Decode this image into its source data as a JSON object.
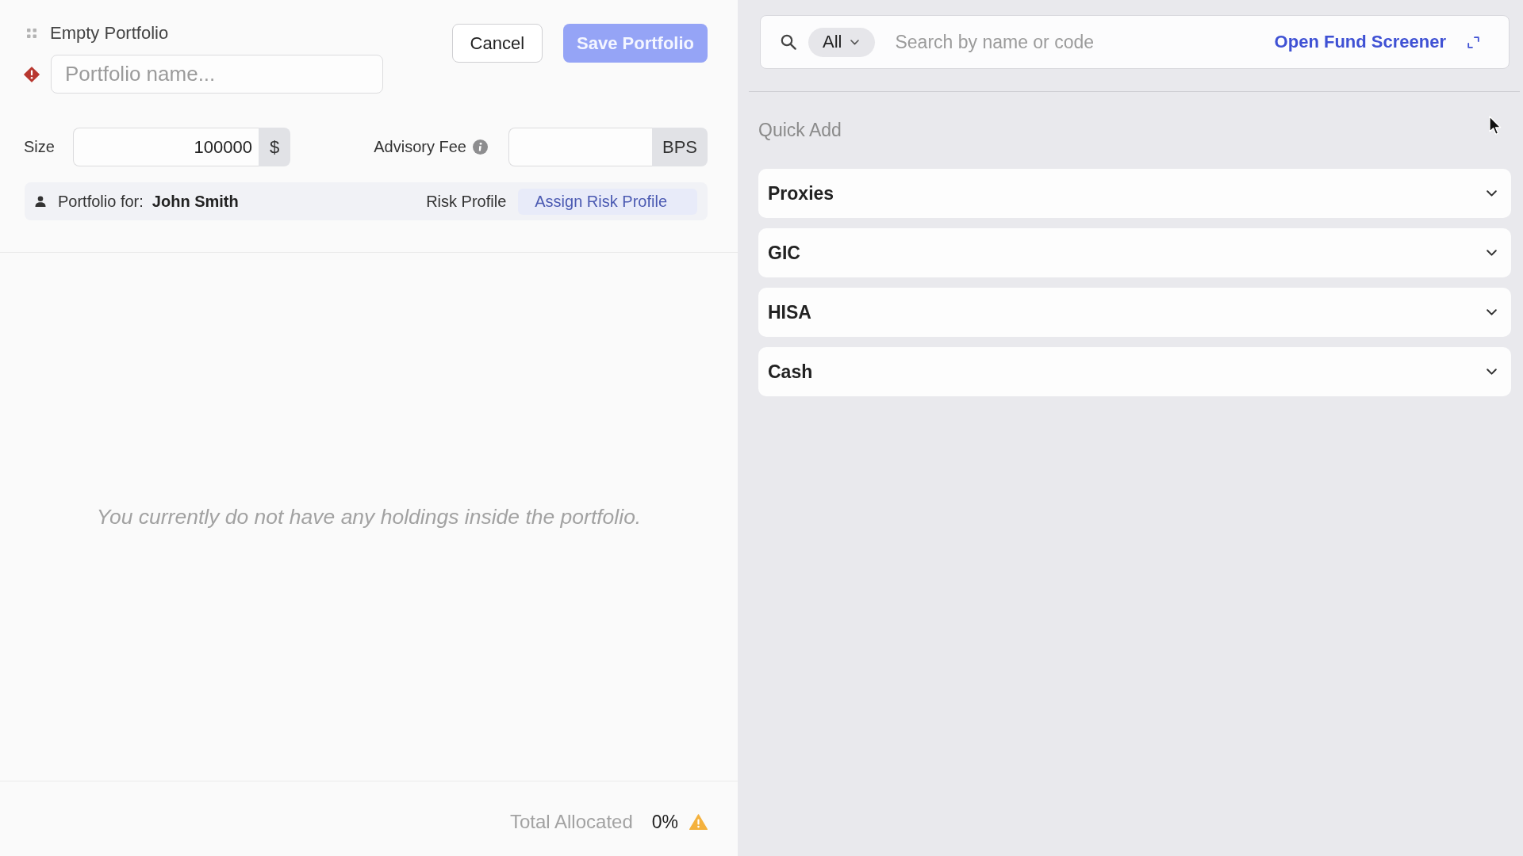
{
  "header": {
    "title": "Empty Portfolio",
    "name_field": {
      "placeholder": "Portfolio name...",
      "error": true
    },
    "buttons": [
      {
        "label": "Cancel",
        "kind": "secondary",
        "disabled": false
      },
      {
        "label": "Save Portfolio",
        "kind": "primary",
        "disabled": true
      }
    ]
  },
  "size": {
    "label": "Size",
    "value": "100000",
    "unit": "$"
  },
  "advisory_fee": {
    "label": "Advisory Fee",
    "unit": "BPS"
  },
  "client": {
    "label": "Portfolio for:",
    "name": "John Smith",
    "risk_label": "Risk Profile",
    "risk_action": "Assign Risk Profile"
  },
  "holdings": {
    "empty_message": "You currently do not have any holdings inside the portfolio."
  },
  "footer": {
    "label": "Total Allocated",
    "value": "0%",
    "warning": true
  },
  "search": {
    "filter": "All",
    "placeholder": "Search by name or code",
    "link": "Open Fund Screener"
  },
  "quick_add": {
    "title": "Quick Add",
    "sections": [
      {
        "label": "Proxies",
        "expanded": false
      },
      {
        "label": "GIC",
        "expanded": false
      },
      {
        "label": "HISA",
        "expanded": false
      },
      {
        "label": "Cash",
        "expanded": false
      }
    ]
  }
}
